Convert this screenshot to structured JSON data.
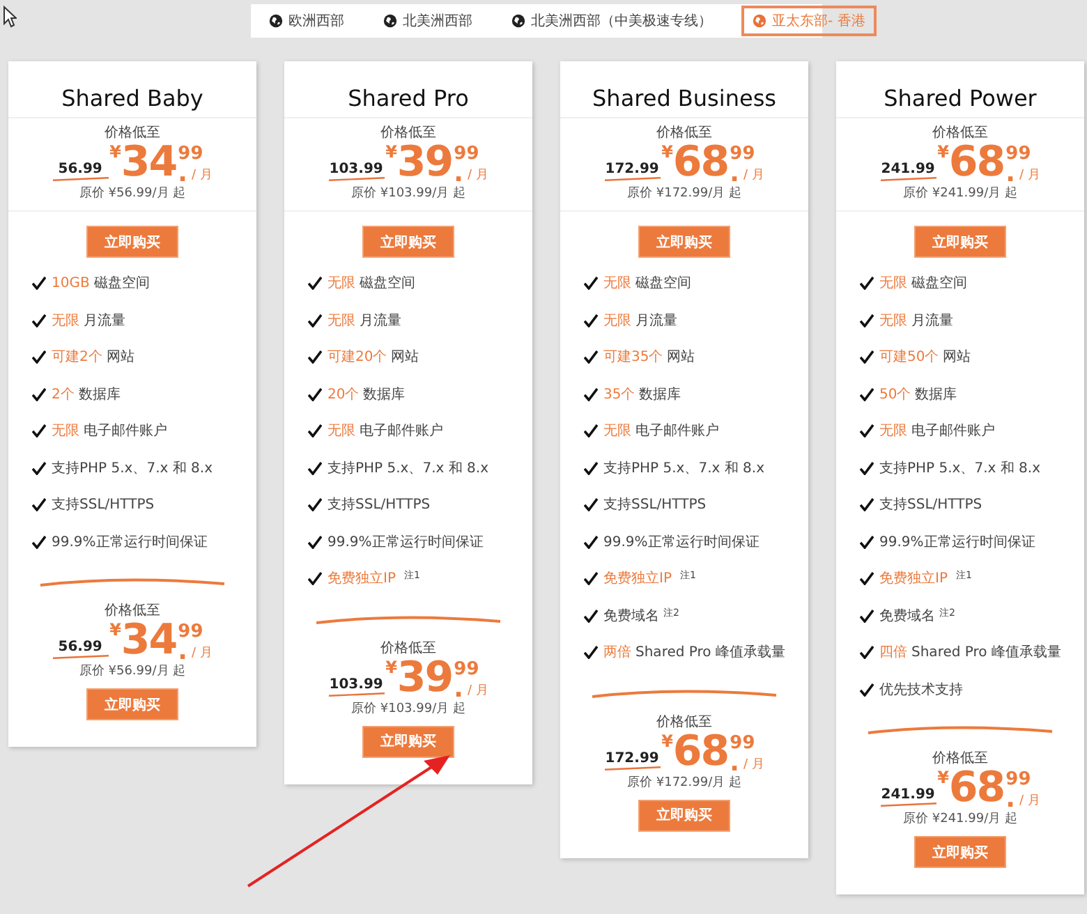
{
  "regions": [
    {
      "label": "欧洲西部",
      "selected": false
    },
    {
      "label": "北美洲西部",
      "selected": false
    },
    {
      "label": "北美洲西部（中美极速专线）",
      "selected": false
    },
    {
      "label": "亚太东部- 香港",
      "selected": true
    }
  ],
  "plans": [
    {
      "name": "Shared Baby",
      "top": {
        "label": "价格低至",
        "old": "56.99",
        "currency": "¥",
        "whole": "34",
        "dot": ".",
        "cents": "99",
        "per": "/ 月",
        "original": "原价 ¥56.99/月 起",
        "button": "立即购买"
      },
      "features": [
        {
          "highlight": "10GB",
          "text": "磁盘空间"
        },
        {
          "highlight": "无限",
          "text": "月流量"
        },
        {
          "highlight": "可建2个",
          "text": "网站"
        },
        {
          "highlight": "2个",
          "text": "数据库"
        },
        {
          "highlight": "无限",
          "text": "电子邮件账户"
        },
        {
          "text": "支持PHP 5.x、7.x 和 8.x"
        },
        {
          "text": "支持SSL/HTTPS"
        },
        {
          "text": "99.9%正常运行时间保证"
        }
      ],
      "bottom": {
        "label": "价格低至",
        "old": "56.99",
        "currency": "¥",
        "whole": "34",
        "dot": ".",
        "cents": "99",
        "per": "/ 月",
        "original": "原价 ¥56.99/月 起",
        "button": "立即购买"
      }
    },
    {
      "name": "Shared Pro",
      "top": {
        "label": "价格低至",
        "old": "103.99",
        "currency": "¥",
        "whole": "39",
        "dot": ".",
        "cents": "99",
        "per": "/ 月",
        "original": "原价 ¥103.99/月 起",
        "button": "立即购买"
      },
      "features": [
        {
          "highlight": "无限",
          "text": "磁盘空间"
        },
        {
          "highlight": "无限",
          "text": "月流量"
        },
        {
          "highlight": "可建20个",
          "text": "网站"
        },
        {
          "highlight": "20个",
          "text": "数据库"
        },
        {
          "highlight": "无限",
          "text": "电子邮件账户"
        },
        {
          "text": "支持PHP 5.x、7.x 和 8.x"
        },
        {
          "text": "支持SSL/HTTPS"
        },
        {
          "text": "99.9%正常运行时间保证"
        },
        {
          "highlight": "免费独立IP",
          "note": "注1"
        }
      ],
      "bottom": {
        "label": "价格低至",
        "old": "103.99",
        "currency": "¥",
        "whole": "39",
        "dot": ".",
        "cents": "99",
        "per": "/ 月",
        "original": "原价 ¥103.99/月 起",
        "button": "立即购买"
      }
    },
    {
      "name": "Shared Business",
      "top": {
        "label": "价格低至",
        "old": "172.99",
        "currency": "¥",
        "whole": "68",
        "dot": ".",
        "cents": "99",
        "per": "/ 月",
        "original": "原价 ¥172.99/月 起",
        "button": "立即购买"
      },
      "features": [
        {
          "highlight": "无限",
          "text": "磁盘空间"
        },
        {
          "highlight": "无限",
          "text": "月流量"
        },
        {
          "highlight": "可建35个",
          "text": "网站"
        },
        {
          "highlight": "35个",
          "text": "数据库"
        },
        {
          "highlight": "无限",
          "text": "电子邮件账户"
        },
        {
          "text": "支持PHP 5.x、7.x 和 8.x"
        },
        {
          "text": "支持SSL/HTTPS"
        },
        {
          "text": "99.9%正常运行时间保证"
        },
        {
          "highlight": "免费独立IP",
          "note": "注1"
        },
        {
          "text": "免费域名",
          "note": "注2"
        },
        {
          "highlight": "两倍",
          "text": "Shared Pro 峰值承载量"
        }
      ],
      "bottom": {
        "label": "价格低至",
        "old": "172.99",
        "currency": "¥",
        "whole": "68",
        "dot": ".",
        "cents": "99",
        "per": "/ 月",
        "original": "原价 ¥172.99/月 起",
        "button": "立即购买"
      }
    },
    {
      "name": "Shared Power",
      "top": {
        "label": "价格低至",
        "old": "241.99",
        "currency": "¥",
        "whole": "68",
        "dot": ".",
        "cents": "99",
        "per": "/ 月",
        "original": "原价 ¥241.99/月 起",
        "button": "立即购买"
      },
      "features": [
        {
          "highlight": "无限",
          "text": "磁盘空间"
        },
        {
          "highlight": "无限",
          "text": "月流量"
        },
        {
          "highlight": "可建50个",
          "text": "网站"
        },
        {
          "highlight": "50个",
          "text": "数据库"
        },
        {
          "highlight": "无限",
          "text": "电子邮件账户"
        },
        {
          "text": "支持PHP 5.x、7.x 和 8.x"
        },
        {
          "text": "支持SSL/HTTPS"
        },
        {
          "text": "99.9%正常运行时间保证"
        },
        {
          "highlight": "免费独立IP",
          "note": "注1"
        },
        {
          "text": "免费域名",
          "note": "注2"
        },
        {
          "highlight": "四倍",
          "text": "Shared Pro 峰值承载量"
        },
        {
          "text": "优先技术支持"
        }
      ],
      "bottom": {
        "label": "价格低至",
        "old": "241.99",
        "currency": "¥",
        "whole": "68",
        "dot": ".",
        "cents": "99",
        "per": "/ 月",
        "original": "原价 ¥241.99/月 起",
        "button": "立即购买"
      }
    }
  ]
}
